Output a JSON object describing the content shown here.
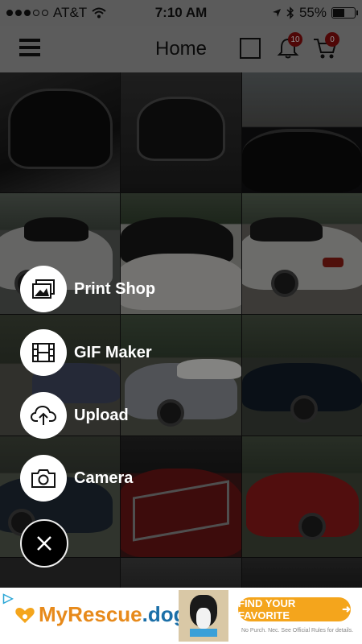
{
  "status_bar": {
    "carrier": "AT&T",
    "time": "7:10 AM",
    "battery": "55%"
  },
  "nav": {
    "title": "Home",
    "notifications_badge": "10",
    "cart_badge": "0"
  },
  "fab_menu": {
    "items": [
      {
        "label": "Print Shop",
        "icon": "photos-icon"
      },
      {
        "label": "GIF Maker",
        "icon": "film-icon"
      },
      {
        "label": "Upload",
        "icon": "cloud-upload-icon"
      },
      {
        "label": "Camera",
        "icon": "camera-icon"
      }
    ],
    "close_icon": "close-icon"
  },
  "ad": {
    "brand_prefix": "My",
    "brand_main": "Rescue",
    "brand_suffix": ".dog",
    "cta": "FIND YOUR FAVORITE",
    "fine_print": "No Purch. Nec. See Official Rules for details."
  },
  "colors": {
    "accent_orange": "#f4a51c",
    "badge_red": "#7a0b0b"
  }
}
